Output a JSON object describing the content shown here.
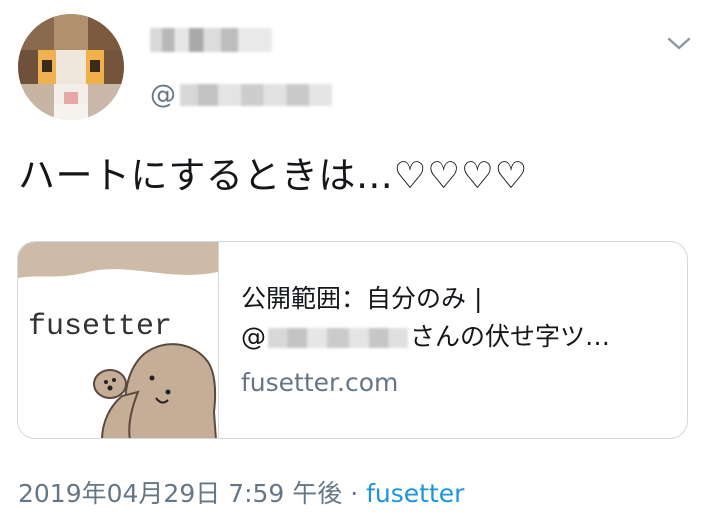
{
  "tweet": {
    "handle_prefix": "@",
    "text": "ハートにするときは…♡♡♡♡",
    "card": {
      "title_line1": "公開範囲：自分のみ |",
      "title_line2_prefix": "@",
      "title_line2_suffix": "さんの伏せ字ツ…",
      "domain": "fusetter.com",
      "thumbnail_text": "fusetter"
    },
    "timestamp": "2019年04月29日 7:59 午後",
    "separator": " · ",
    "source": "fusetter"
  },
  "icons": {
    "menu": "chevron-down-icon"
  },
  "colors": {
    "text": "#14171a",
    "secondary": "#657786",
    "link": "#1b95e0",
    "border": "#cfd9de"
  }
}
